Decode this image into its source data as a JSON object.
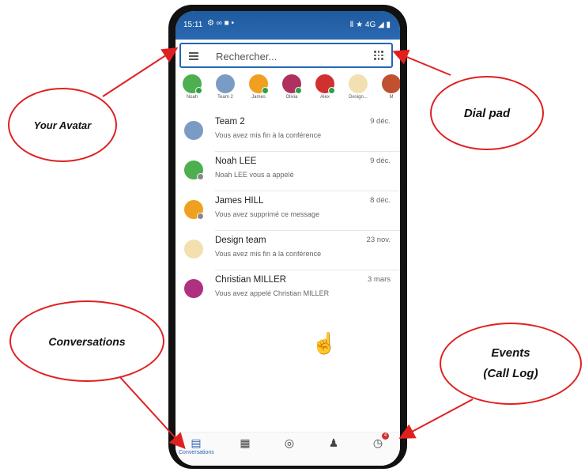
{
  "status_bar": {
    "time": "15:11",
    "sys_icons": "⚙ ∞ ■ •",
    "right_icons": "Ⅱ ★ 4G ◢ ▮"
  },
  "search": {
    "placeholder": "Rechercher..."
  },
  "favorites": [
    {
      "label": "Noah",
      "color": "#4caf50"
    },
    {
      "label": "Team 2",
      "color": "#7a9cc4"
    },
    {
      "label": "James",
      "color": "#f0a020"
    },
    {
      "label": "Olivia",
      "color": "#b03060"
    },
    {
      "label": "Alex",
      "color": "#d03030"
    },
    {
      "label": "Design...",
      "color": "#f3e0b0"
    },
    {
      "label": "M",
      "color": "#c05030"
    }
  ],
  "conversations": [
    {
      "name": "Team 2",
      "date": "9 déc.",
      "message": "Vous avez mis fin à la conférence",
      "color": "#7a9cc4"
    },
    {
      "name": "Noah LEE",
      "date": "9 déc.",
      "message": "Noah LEE vous a appelé",
      "color": "#4caf50"
    },
    {
      "name": "James HILL",
      "date": "8 déc.",
      "message": "Vous avez supprimé ce message",
      "color": "#f0a020"
    },
    {
      "name": "Design team",
      "date": "23 nov.",
      "message": "Vous avez mis fin à la conférence",
      "color": "#f3e0b0"
    },
    {
      "name": "Christian MILLER",
      "date": "3 mars",
      "message": "Vous avez appelé Christian MILLER",
      "color": "#b03080"
    }
  ],
  "tabs": {
    "conversations_label": "Conversations",
    "events_badge": "4"
  },
  "callouts": {
    "avatar": "Your Avatar",
    "dialpad": "Dial pad",
    "conversations": "Conversations",
    "events_line1": "Events",
    "events_line2": "(Call Log)"
  },
  "colors": {
    "accent": "#2a63b8",
    "callout_border": "#e02020"
  }
}
